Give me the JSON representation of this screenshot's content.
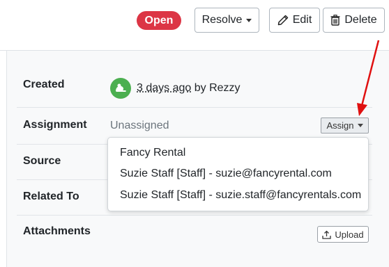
{
  "header": {
    "status_badge": "Open",
    "resolve_label": "Resolve",
    "edit_label": "Edit",
    "delete_label": "Delete"
  },
  "details": {
    "created_label": "Created",
    "created_time": "3 days ago",
    "created_by": "by Rezzy",
    "assignment_label": "Assignment",
    "assignment_value": "Unassigned",
    "assign_button": "Assign",
    "source_label": "Source",
    "related_label": "Related To",
    "attachments_label": "Attachments",
    "upload_button": "Upload"
  },
  "assign_dropdown": {
    "options": [
      "Fancy Rental",
      "Suzie Staff [Staff] - suzie@fancyrental.com",
      "Suzie Staff [Staff] - suzie.staff@fancyrentals.com"
    ]
  },
  "colors": {
    "open_badge": "#dc3545",
    "avatar": "#4caf50",
    "annotation_arrow": "#e01010"
  },
  "icons": [
    "pencil-icon",
    "trash-icon",
    "avatar-icon",
    "upload-icon",
    "caret-down-icon"
  ]
}
